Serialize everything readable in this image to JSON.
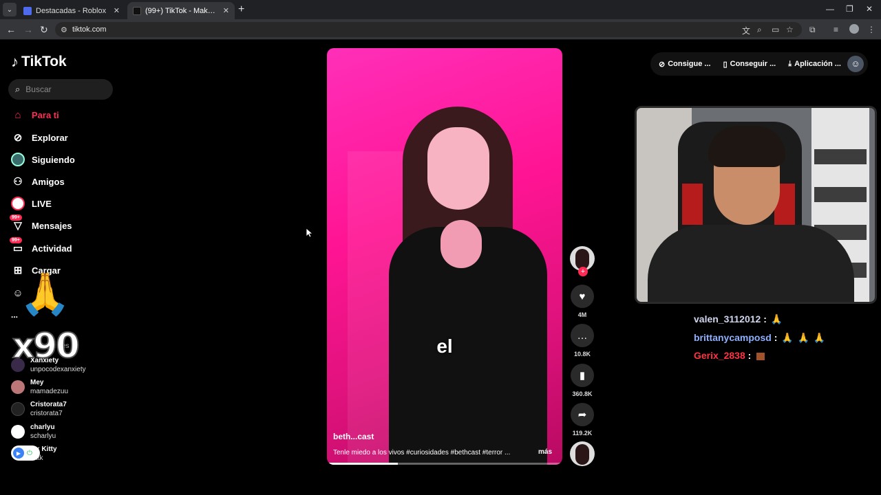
{
  "browser": {
    "tabs": [
      {
        "title": "Destacadas - Roblox",
        "favicon_color": "#4f6bed"
      },
      {
        "title": "(99+) TikTok - Make Your Day",
        "favicon_color": "#111111"
      }
    ],
    "url": "tiktok.com"
  },
  "sidebar": {
    "logo": "TikTok",
    "search_placeholder": "Buscar",
    "nav": [
      {
        "label": "Para ti",
        "icon": "home-icon",
        "active": true
      },
      {
        "label": "Explorar",
        "icon": "compass-icon"
      },
      {
        "label": "Siguiendo",
        "icon": "following-avatar-icon"
      },
      {
        "label": "Amigos",
        "icon": "friends-icon"
      },
      {
        "label": "LIVE",
        "icon": "live-icon"
      },
      {
        "label": "Mensajes",
        "icon": "messages-icon",
        "badge": "99+"
      },
      {
        "label": "Actividad",
        "icon": "activity-icon",
        "badge": "99+"
      },
      {
        "label": "Cargar",
        "icon": "upload-icon"
      }
    ],
    "more": "...",
    "following_header": "es",
    "following": [
      {
        "name": "Xanxiety",
        "handle": "unpocodexanxiety"
      },
      {
        "name": "Mey",
        "handle": "mamadezuu"
      },
      {
        "name": "Cristorata7",
        "handle": "cristorata7"
      },
      {
        "name": "charlyu",
        "handle": "scharlyu"
      },
      {
        "name": "x Kitty",
        "handle": "ttk"
      }
    ]
  },
  "overlay": {
    "multiplier": "x90"
  },
  "video": {
    "caption_word": "el",
    "author": "beth...cast",
    "description": "Tenle miedo a los vivos #curiosidades #bethcast #terror ...",
    "more_label": "más",
    "progress": 0.3
  },
  "actions": {
    "likes": "4M",
    "comments": "10.8K",
    "saves": "360.8K",
    "shares": "119.2K"
  },
  "topbar": {
    "coins": "Consigue ...",
    "app": "Conseguir ...",
    "download": "Aplicación ..."
  },
  "chat": [
    {
      "user": "valen_3112012",
      "sep": ":"
    },
    {
      "user": "brittanycamposd",
      "sep": ":"
    },
    {
      "user": "Gerix_2838",
      "sep": ":"
    }
  ]
}
